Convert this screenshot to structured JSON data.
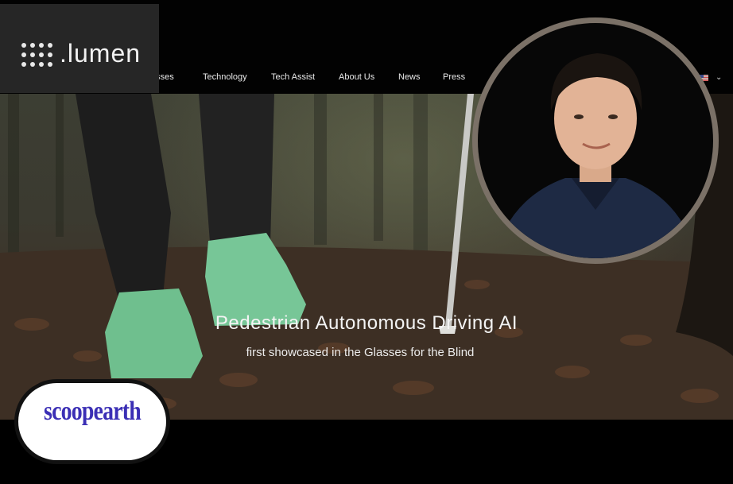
{
  "logo": {
    "text": ".lumen",
    "icon": "dot-grid-logo-icon"
  },
  "nav": {
    "items": [
      {
        "label": "asses"
      },
      {
        "label": "Technology"
      },
      {
        "label": "Tech Assist"
      },
      {
        "label": "About Us"
      },
      {
        "label": "News"
      },
      {
        "label": "Press"
      }
    ],
    "language_icon": "us-flag-icon",
    "dropdown_icon": "chevron-down-icon",
    "dropdown_glyph": "⌄"
  },
  "hero": {
    "title": "Pedestrian Autonomous Driving AI",
    "subtitle": "first showcased in the Glasses for the Blind"
  },
  "badge": {
    "text": "scoopearth"
  },
  "colors": {
    "nav_background": "#020202",
    "logo_box": "#262626",
    "badge_text": "#3b2fb5",
    "portrait_ring": "#7b7167"
  }
}
